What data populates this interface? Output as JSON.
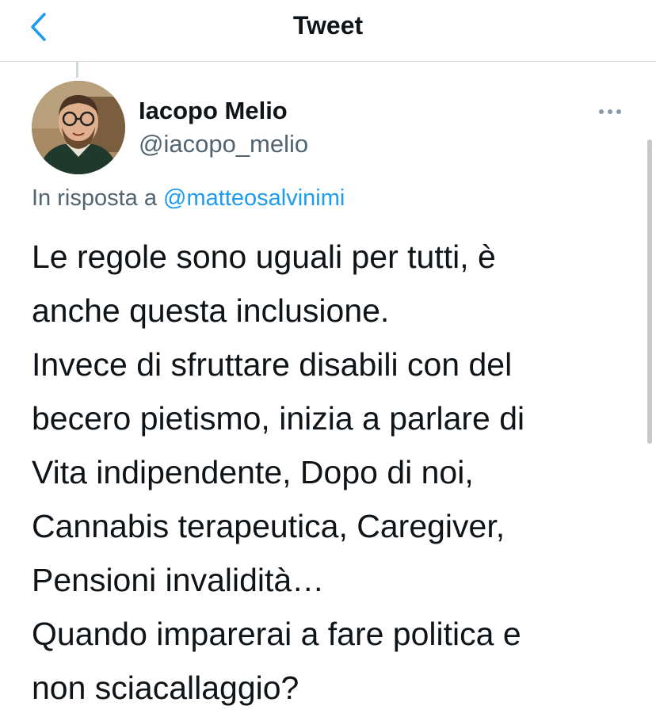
{
  "header": {
    "title": "Tweet",
    "back_icon": "chevron-left-icon",
    "accent_color": "#1d9bf0"
  },
  "tweet": {
    "author": {
      "name": "Iacopo Melio",
      "handle": "@iacopo_melio"
    },
    "reply": {
      "prefix": "In risposta a",
      "mention": "@matteosalvinimi"
    },
    "text_lines": [
      "Le regole sono uguali per tutti, è",
      "anche questa inclusione.",
      "Invece di sfruttare disabili con del",
      "becero pietismo, inizia a parlare di",
      "Vita indipendente, Dopo di noi,",
      "Cannabis terapeutica, Caregiver,",
      "Pensioni invalidità…",
      "Quando imparerai a fare politica e",
      "non sciacallaggio?"
    ]
  }
}
